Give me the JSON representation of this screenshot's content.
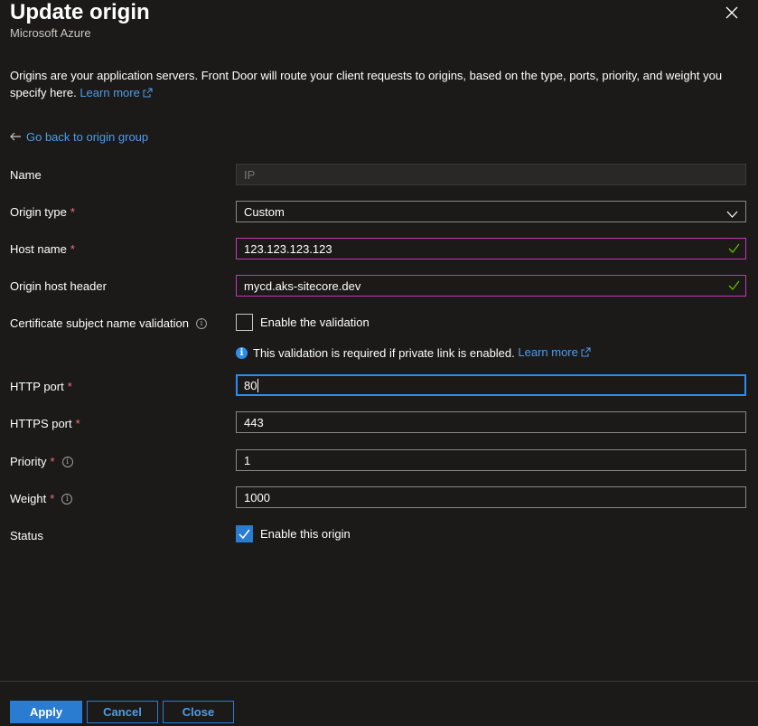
{
  "header": {
    "title": "Update origin",
    "subtitle": "Microsoft Azure"
  },
  "description": {
    "text": "Origins are your application servers. Front Door will route your client requests to origins, based on the type, ports, priority, and weight you specify here.",
    "learn_more": "Learn more"
  },
  "back_link": "Go back to origin group",
  "form": {
    "name": {
      "label": "Name",
      "placeholder": "IP"
    },
    "origin_type": {
      "label": "Origin type",
      "required": "*",
      "value": "Custom"
    },
    "host_name": {
      "label": "Host name",
      "required": "*",
      "value": "123.123.123.123"
    },
    "origin_host_header": {
      "label": "Origin host header",
      "value": "mycd.aks-sitecore.dev"
    },
    "cert_validation": {
      "label": "Certificate subject name validation",
      "checkbox_label": "Enable the validation",
      "checked": false,
      "note": "This validation is required if private link is enabled.",
      "note_link": "Learn more"
    },
    "http_port": {
      "label": "HTTP port",
      "required": "*",
      "value": "80"
    },
    "https_port": {
      "label": "HTTPS port",
      "required": "*",
      "value": "443"
    },
    "priority": {
      "label": "Priority",
      "required": "*",
      "value": "1"
    },
    "weight": {
      "label": "Weight",
      "required": "*",
      "value": "1000"
    },
    "status": {
      "label": "Status",
      "checkbox_label": "Enable this origin",
      "checked": true
    }
  },
  "footer": {
    "apply": "Apply",
    "cancel": "Cancel",
    "close": "Close"
  },
  "colors": {
    "background": "#1b1a19",
    "accent": "#2a7cd1",
    "link": "#4f9ce8",
    "required": "#f1707b",
    "valid_border": "#c239b3",
    "valid_check": "#6bb700"
  }
}
